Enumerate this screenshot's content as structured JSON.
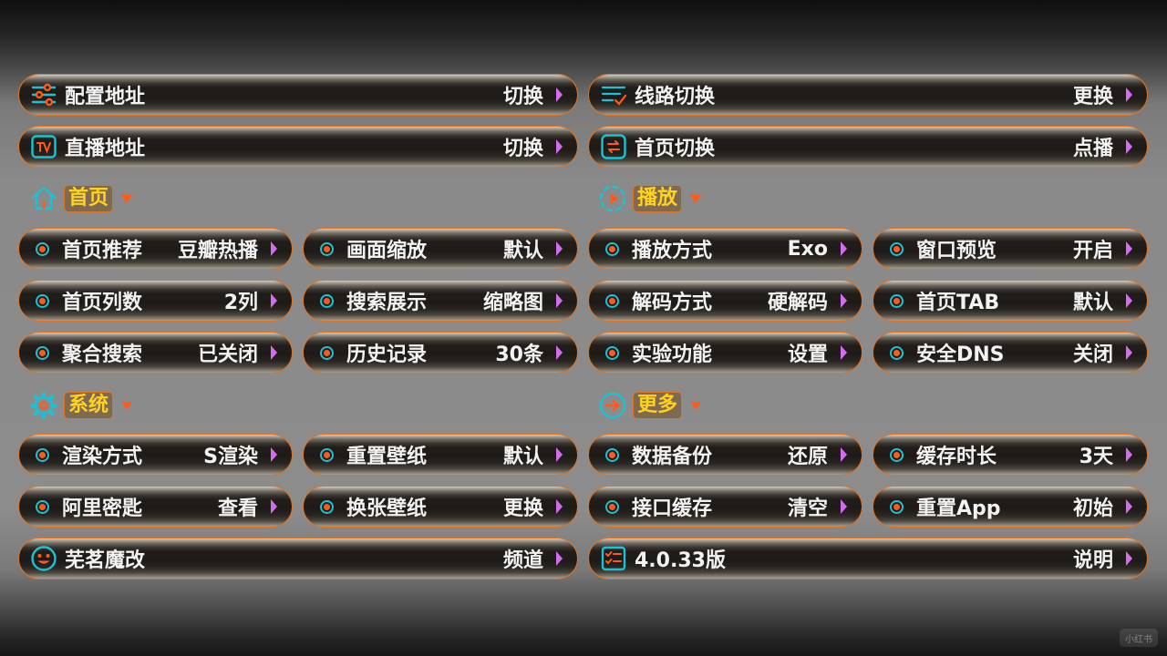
{
  "top_rows": [
    {
      "label": "配置地址",
      "value": "切换",
      "icon": "sliders-icon"
    },
    {
      "label": "线路切换",
      "value": "更换",
      "icon": "list-check-icon"
    },
    {
      "label": "直播地址",
      "value": "切换",
      "icon": "tv-icon"
    },
    {
      "label": "首页切换",
      "value": "点播",
      "icon": "switch-icon"
    }
  ],
  "sections": {
    "home": {
      "title": "首页",
      "icon": "home-icon"
    },
    "play": {
      "title": "播放",
      "icon": "play-circle-icon"
    },
    "system": {
      "title": "系统",
      "icon": "gear-icon"
    },
    "more": {
      "title": "更多",
      "icon": "arrow-right-circle-icon"
    }
  },
  "home_items": [
    {
      "label": "首页推荐",
      "value": "豆瓣热播"
    },
    {
      "label": "画面缩放",
      "value": "默认"
    },
    {
      "label": "首页列数",
      "value": "2列"
    },
    {
      "label": "搜索展示",
      "value": "缩略图"
    },
    {
      "label": "聚合搜索",
      "value": "已关闭"
    },
    {
      "label": "历史记录",
      "value": "30条"
    }
  ],
  "play_items": [
    {
      "label": "播放方式",
      "value": "Exo"
    },
    {
      "label": "窗口预览",
      "value": "开启"
    },
    {
      "label": "解码方式",
      "value": "硬解码"
    },
    {
      "label": "首页TAB",
      "value": "默认"
    },
    {
      "label": "实验功能",
      "value": "设置"
    },
    {
      "label": "安全DNS",
      "value": "关闭"
    }
  ],
  "system_items": [
    {
      "label": "渲染方式",
      "value": "S渲染"
    },
    {
      "label": "重置壁纸",
      "value": "默认"
    },
    {
      "label": "阿里密匙",
      "value": "查看"
    },
    {
      "label": "换张壁纸",
      "value": "更换"
    }
  ],
  "more_items": [
    {
      "label": "数据备份",
      "value": "还原"
    },
    {
      "label": "缓存时长",
      "value": "3天"
    },
    {
      "label": "接口缓存",
      "value": "清空"
    },
    {
      "label": "重置App",
      "value": "初始"
    }
  ],
  "bottom_rows": [
    {
      "label": "芜茗魔改",
      "value": "频道",
      "icon": "smiley-icon"
    },
    {
      "label": "4.0.33版",
      "value": "说明",
      "icon": "checklist-icon"
    }
  ],
  "watermark": "小红书",
  "colors": {
    "accent_orange": "#e0731f",
    "accent_cyan": "#19c3d6",
    "section_yellow": "#ffd21f",
    "chevron_purple": "#d46cf0",
    "arrow_orange": "#ff5a1a"
  }
}
